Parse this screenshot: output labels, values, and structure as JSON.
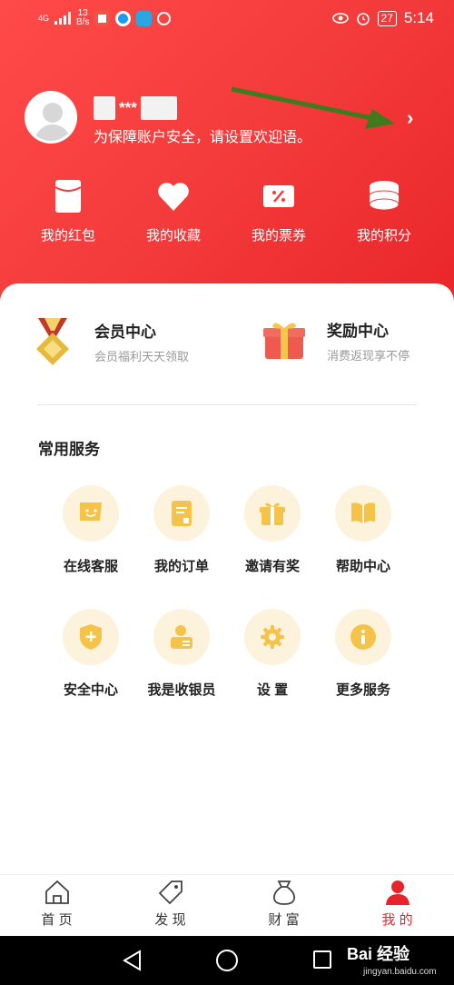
{
  "status_bar": {
    "network": "4G",
    "speed_value": "13",
    "speed_unit": "B/s",
    "battery": "27",
    "time": "5:14",
    "icons": [
      "signal-icon",
      "weibo-app-icon",
      "browser-app-icon",
      "telegram-app-icon",
      "circle-app-icon",
      "eye-icon",
      "alarm-icon",
      "battery-icon"
    ]
  },
  "profile": {
    "username_masked": "***",
    "welcome_prompt": "为保障账户安全，请设置欢迎语。",
    "chevron": "›"
  },
  "quick_actions": [
    {
      "label": "我的红包",
      "icon": "red-envelope-icon"
    },
    {
      "label": "我的收藏",
      "icon": "heart-icon"
    },
    {
      "label": "我的票券",
      "icon": "coupon-icon"
    },
    {
      "label": "我的积分",
      "icon": "coins-stack-icon"
    }
  ],
  "features": {
    "member": {
      "title": "会员中心",
      "subtitle": "会员福利天天领取",
      "icon": "medal-icon"
    },
    "reward": {
      "title": "奖励中心",
      "subtitle": "消费返现享不停",
      "icon": "gift-box-icon"
    }
  },
  "services": {
    "title": "常用服务",
    "items": [
      {
        "label": "在线客服",
        "icon": "chat-bubble-icon"
      },
      {
        "label": "我的订单",
        "icon": "order-doc-icon"
      },
      {
        "label": "邀请有奖",
        "icon": "gift-icon"
      },
      {
        "label": "帮助中心",
        "icon": "book-icon"
      },
      {
        "label": "安全中心",
        "icon": "shield-icon"
      },
      {
        "label": "我是收银员",
        "icon": "cashier-icon"
      },
      {
        "label": "设 置",
        "icon": "gear-icon"
      },
      {
        "label": "更多服务",
        "icon": "info-icon"
      }
    ]
  },
  "tab_bar": [
    {
      "label": "首 页",
      "icon": "home-icon",
      "active": false
    },
    {
      "label": "发 现",
      "icon": "tag-icon",
      "active": false
    },
    {
      "label": "财 富",
      "icon": "money-bag-icon",
      "active": false
    },
    {
      "label": "我 的",
      "icon": "person-icon",
      "active": true
    }
  ],
  "watermark": {
    "brand": "Bai 经验",
    "url": "jingyan.baidu.com"
  },
  "colors": {
    "primary_red": "#e8232a",
    "service_bg": "#fdf3dc",
    "service_icon": "#f5c34a"
  }
}
